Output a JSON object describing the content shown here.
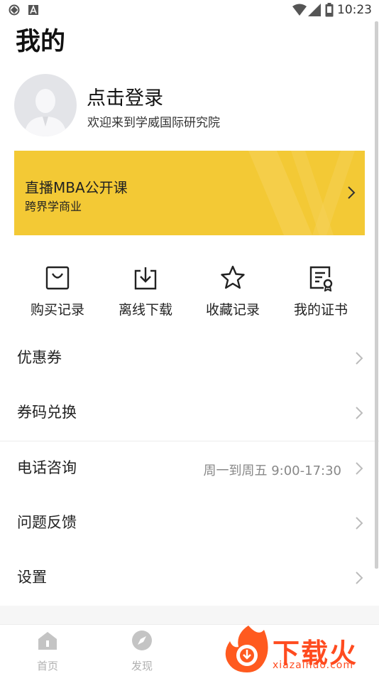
{
  "status_bar": {
    "time": "10:23",
    "left_icons": [
      "sync-icon",
      "font-icon"
    ],
    "right_icons": [
      "wifi-icon",
      "signal-icon",
      "battery-icon"
    ]
  },
  "page_title": "我的",
  "profile": {
    "login_label": "点击登录",
    "welcome_text": "欢迎来到学威国际研究院"
  },
  "banner": {
    "title": "直播MBA公开课",
    "subtitle": "跨界学商业",
    "background_color": "#f3c935"
  },
  "quick_actions": [
    {
      "label": "购买记录",
      "icon": "shopping-bag-icon"
    },
    {
      "label": "离线下载",
      "icon": "download-icon"
    },
    {
      "label": "收藏记录",
      "icon": "star-icon"
    },
    {
      "label": "我的证书",
      "icon": "certificate-icon"
    }
  ],
  "menu": [
    {
      "label": "优惠券",
      "value": ""
    },
    {
      "label": "券码兑换",
      "value": ""
    },
    {
      "label": "电话咨询",
      "value": "周一到周五 9:00-17:30"
    },
    {
      "label": "问题反馈",
      "value": ""
    },
    {
      "label": "设置",
      "value": ""
    }
  ],
  "bottom_nav": [
    {
      "label": "首页",
      "icon": "home-icon"
    },
    {
      "label": "发现",
      "icon": "compass-icon"
    }
  ],
  "watermark": {
    "brand": "下载火",
    "url": "xiazaihuo.com",
    "color": "#ff4b1f"
  }
}
